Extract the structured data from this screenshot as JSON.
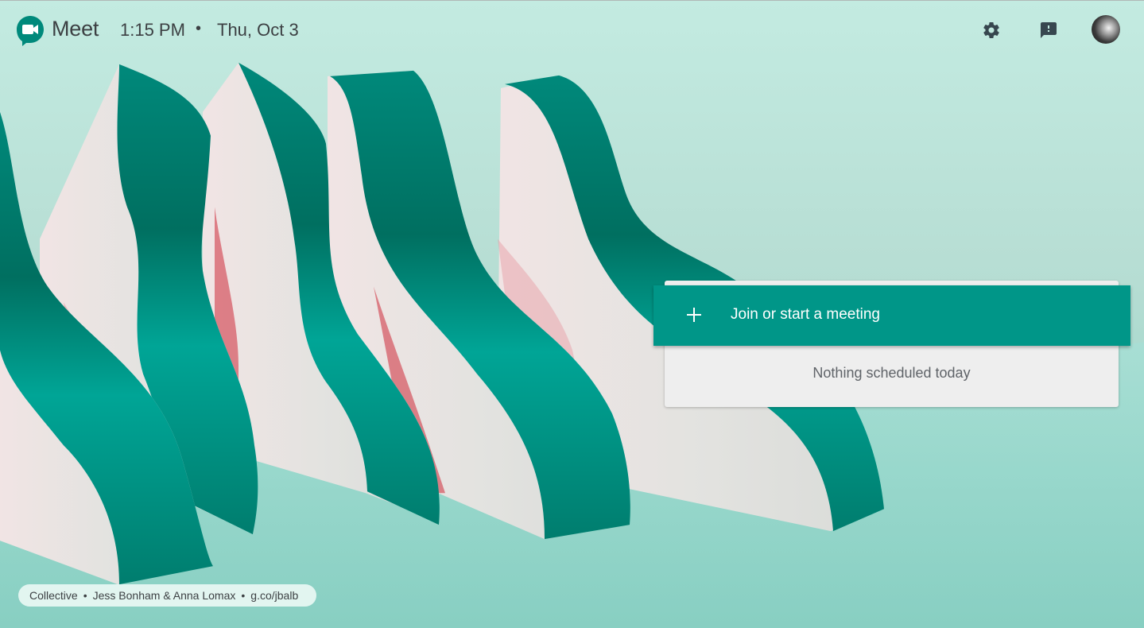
{
  "header": {
    "app_name": "Meet",
    "time": "1:15 PM",
    "separator": "•",
    "date": "Thu, Oct 3",
    "icons": {
      "logo": "google-meet-logo",
      "settings": "gear-icon",
      "feedback": "feedback-icon",
      "avatar": "user-avatar"
    }
  },
  "card": {
    "join_button_icon": "plus-icon",
    "join_button_label": "Join or start a meeting",
    "empty_state": "Nothing scheduled today"
  },
  "credit": {
    "collection": "Collective",
    "artists": "Jess Bonham & Anna Lomax",
    "link": "g.co/jbalb",
    "separator": "•"
  },
  "colors": {
    "accent": "#009688",
    "text_dark": "#3c4043",
    "text_muted": "#5f6368",
    "card_bg": "#eeeeee"
  }
}
